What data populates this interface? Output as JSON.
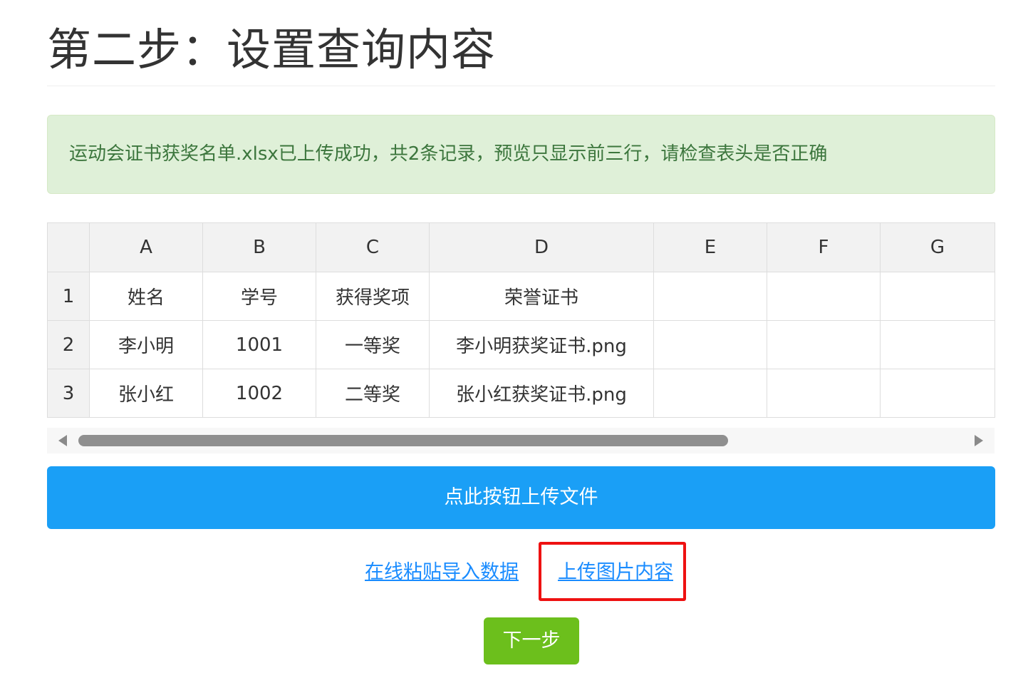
{
  "page": {
    "title": "第二步：设置查询内容"
  },
  "alert": {
    "message": "运动会证书获奖名单.xlsx已上传成功，共2条记录，预览只显示前三行，请检查表头是否正确"
  },
  "sheet": {
    "columns": [
      "",
      "A",
      "B",
      "C",
      "D",
      "E",
      "F",
      "G"
    ],
    "rows": [
      [
        "1",
        "姓名",
        "学号",
        "获得奖项",
        "荣誉证书",
        "",
        "",
        ""
      ],
      [
        "2",
        "李小明",
        "1001",
        "一等奖",
        "李小明获奖证书.png",
        "",
        "",
        ""
      ],
      [
        "3",
        "张小红",
        "1002",
        "二等奖",
        "张小红获奖证书.png",
        "",
        "",
        ""
      ]
    ]
  },
  "actions": {
    "upload_label": "点此按钮上传文件",
    "paste_link": "在线粘贴导入数据",
    "image_link": "上传图片内容",
    "next_label": "下一步"
  },
  "colors": {
    "upload_button": "#1a9ff6",
    "next_button": "#6cbf1c",
    "alert_bg": "#dff0d8",
    "alert_text": "#3c763d",
    "highlight": "#ee1111",
    "link": "#1a8cff"
  }
}
